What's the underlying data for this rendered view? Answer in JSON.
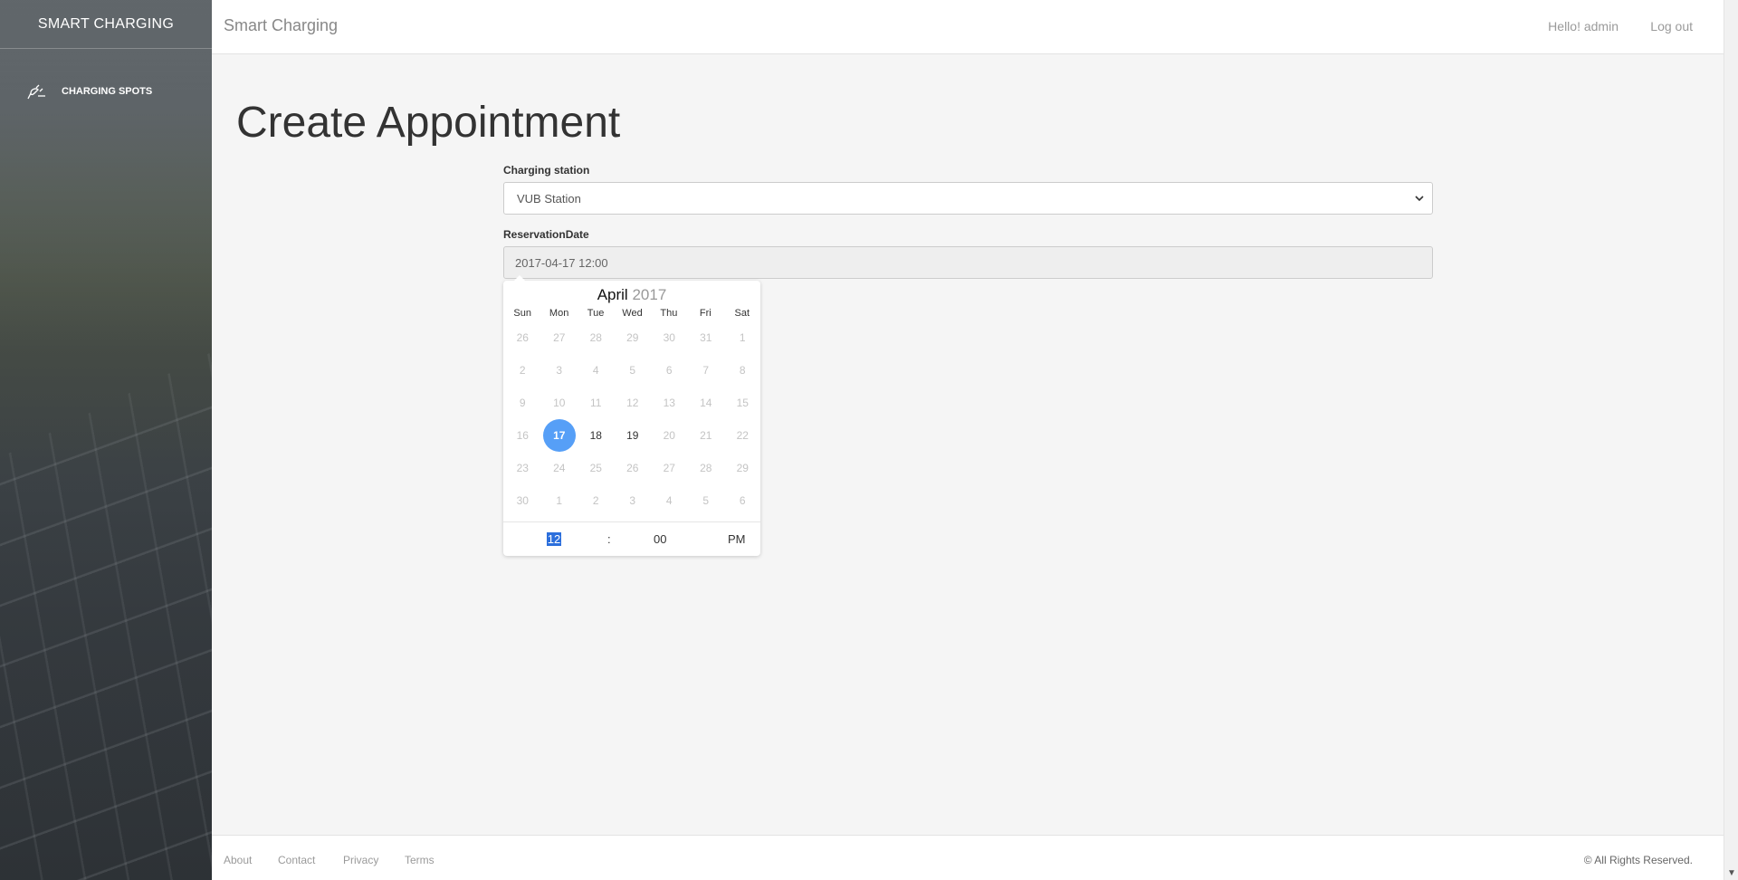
{
  "sidebar": {
    "brand": "SMART CHARGING",
    "items": [
      {
        "label": "CHARGING SPOTS",
        "icon": "plug-icon"
      }
    ]
  },
  "topbar": {
    "title": "Smart Charging",
    "greeting": "Hello! admin",
    "logout": "Log out"
  },
  "main": {
    "title": "Create Appointment",
    "station_label": "Charging station",
    "station_value": "VUB Station",
    "date_label": "ReservationDate",
    "date_value": "2017-04-17 12:00"
  },
  "calendar": {
    "month": "April",
    "year": "2017",
    "weekdays": [
      "Sun",
      "Mon",
      "Tue",
      "Wed",
      "Thu",
      "Fri",
      "Sat"
    ],
    "days": [
      [
        "26",
        "27",
        "28",
        "29",
        "30",
        "31",
        "1"
      ],
      [
        "2",
        "3",
        "4",
        "5",
        "6",
        "7",
        "8"
      ],
      [
        "9",
        "10",
        "11",
        "12",
        "13",
        "14",
        "15"
      ],
      [
        "16",
        "17",
        "18",
        "19",
        "20",
        "21",
        "22"
      ],
      [
        "23",
        "24",
        "25",
        "26",
        "27",
        "28",
        "29"
      ],
      [
        "30",
        "1",
        "2",
        "3",
        "4",
        "5",
        "6"
      ]
    ],
    "selected_day": "17",
    "enabled_days": [
      "17",
      "18",
      "19"
    ],
    "time": {
      "hour": "12",
      "separator": ":",
      "minute": "00",
      "ampm": "PM"
    },
    "accent_color": "#569ff7"
  },
  "footer": {
    "links": [
      "About",
      "Contact",
      "Privacy",
      "Terms"
    ],
    "copyright": "© All Rights Reserved."
  }
}
